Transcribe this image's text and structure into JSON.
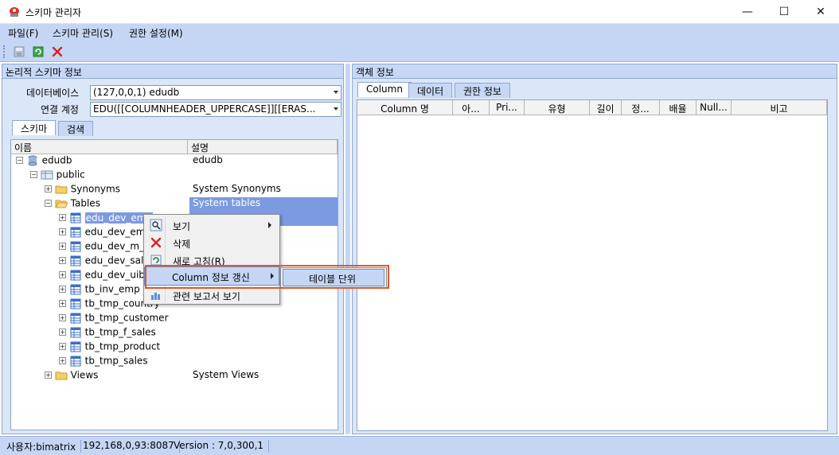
{
  "window": {
    "title": "스키마 관리자"
  },
  "menus": [
    "파일(F)",
    "스키마 관리(S)",
    "권한 설정(M)"
  ],
  "toolbar": {
    "buttons": [
      "save-icon",
      "refresh-icon",
      "close-icon"
    ]
  },
  "left_panel": {
    "header": "논리적 스키마 정보",
    "db_label": "데이터베이스",
    "db_value": "(127,0,0,1) edudb",
    "conn_label": "연결 계정",
    "conn_value": "EDU([[COLUMNHEADER_UPPERCASE]][[ERAS...",
    "tabs": [
      "스키마",
      "검색"
    ],
    "columns": [
      "이름",
      "설명"
    ],
    "tree": [
      {
        "label": "edudb",
        "desc": "edudb"
      },
      {
        "label": "public",
        "desc": ""
      },
      {
        "label": "Synonyms",
        "desc": "System Synonyms"
      },
      {
        "label": "Tables",
        "desc": "System tables"
      },
      {
        "label": "edu_dev_emp",
        "desc": ""
      },
      {
        "label": "edu_dev_emp",
        "desc": ""
      },
      {
        "label": "edu_dev_m_s",
        "desc": ""
      },
      {
        "label": "edu_dev_sale",
        "desc": ""
      },
      {
        "label": "edu_dev_uibc",
        "desc": ""
      },
      {
        "label": "tb_inv_emp",
        "desc": ""
      },
      {
        "label": "tb_tmp_country",
        "desc": ""
      },
      {
        "label": "tb_tmp_customer",
        "desc": ""
      },
      {
        "label": "tb_tmp_f_sales",
        "desc": ""
      },
      {
        "label": "tb_tmp_product",
        "desc": ""
      },
      {
        "label": "tb_tmp_sales",
        "desc": ""
      },
      {
        "label": "Views",
        "desc": "System Views"
      }
    ]
  },
  "context_menu": {
    "items": [
      "보기",
      "삭제",
      "새로 고침(R)",
      "Column 정보 갱신",
      "관련 보고서 보기"
    ],
    "submenu": [
      "테이블 단위"
    ]
  },
  "right_panel": {
    "header": "객체 정보",
    "tabs": [
      "Column",
      "데이터",
      "권한 정보"
    ],
    "columns": [
      "Column 명",
      "아...",
      "Pri...",
      "유형",
      "길이",
      "정...",
      "배율",
      "Null...",
      "비고"
    ]
  },
  "status": {
    "user": "사용자:bimatrix",
    "address": "192,168,0,93:8087",
    "version": "Version : 7,0,300,1"
  },
  "colors": {
    "accent": "#c5d6f5",
    "highlight": "#7c9ae0",
    "outline": "#e0562a"
  }
}
